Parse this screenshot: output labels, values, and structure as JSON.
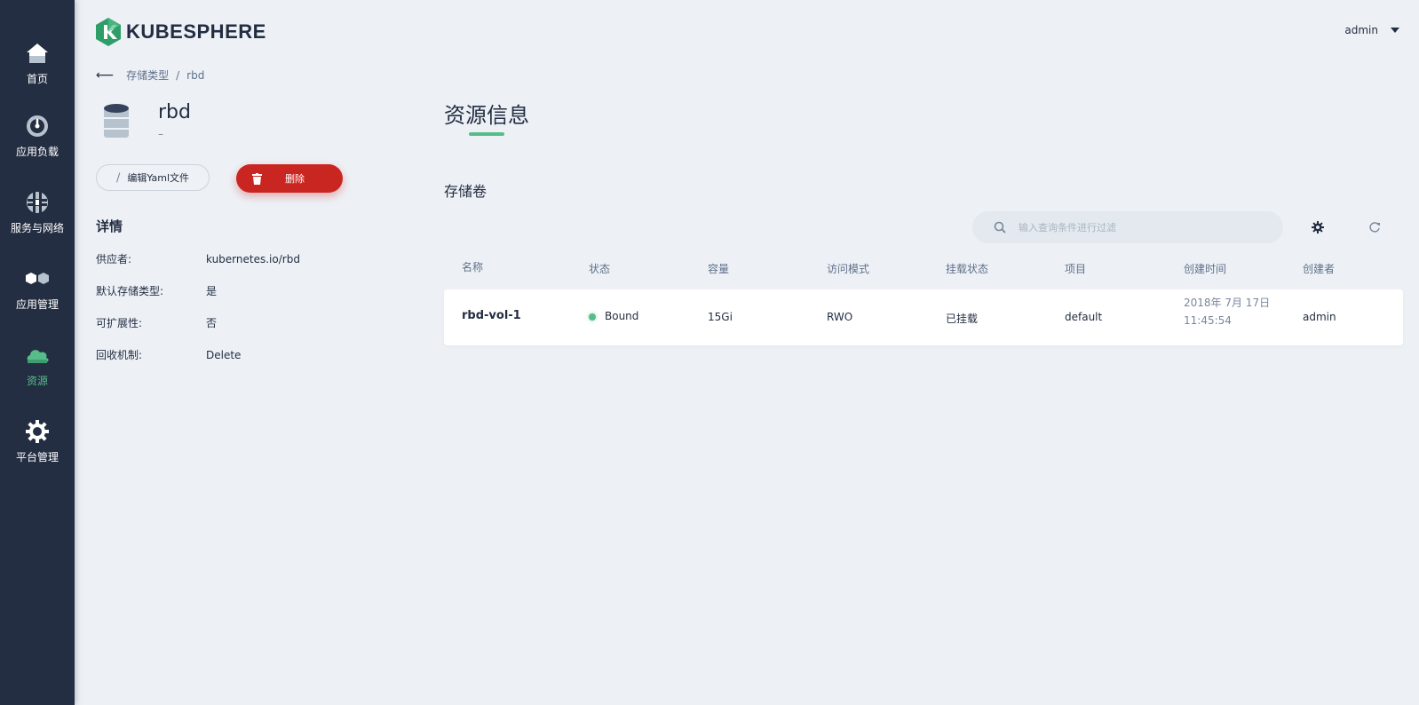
{
  "app": {
    "brand": "KUBESPHERE",
    "user": "admin"
  },
  "nav": {
    "items": [
      {
        "label": "首页",
        "icon": "home-icon"
      },
      {
        "label": "应用负载",
        "icon": "dashboard-icon"
      },
      {
        "label": "服务与网络",
        "icon": "network-icon"
      },
      {
        "label": "应用管理",
        "icon": "hexagons-icon"
      },
      {
        "label": "资源",
        "icon": "cloud-icon"
      },
      {
        "label": "平台管理",
        "icon": "gear-icon"
      }
    ],
    "active_index": 4
  },
  "breadcrumb": {
    "parent": "存储类型",
    "separator": "/",
    "current": "rbd"
  },
  "resource": {
    "name": "rbd",
    "description": "–"
  },
  "actions": {
    "edit_label": "编辑Yaml文件",
    "delete_label": "删除"
  },
  "details": {
    "title": "详情",
    "rows": [
      {
        "key": "供应者:",
        "value": "kubernetes.io/rbd"
      },
      {
        "key": "默认存储类型:",
        "value": "是"
      },
      {
        "key": "可扩展性:",
        "value": "否"
      },
      {
        "key": "回收机制:",
        "value": "Delete"
      }
    ]
  },
  "main": {
    "title": "资源信息",
    "subtitle": "存储卷",
    "search_placeholder": "输入查询条件进行过滤",
    "columns": [
      "名称",
      "状态",
      "容量",
      "访问模式",
      "挂载状态",
      "项目",
      "创建时间",
      "创建者"
    ],
    "rows": [
      {
        "name": "rbd-vol-1",
        "status": "Bound",
        "capacity": "15Gi",
        "access_mode": "RWO",
        "mount_status": "已挂载",
        "project": "default",
        "created_date": "2018年 7月 17日",
        "created_time": "11:45:54",
        "creator": "admin"
      }
    ]
  },
  "colors": {
    "sidebar": "#242e42",
    "accent": "#55bc8a",
    "danger": "#ca2621",
    "background": "#edf1f6"
  }
}
